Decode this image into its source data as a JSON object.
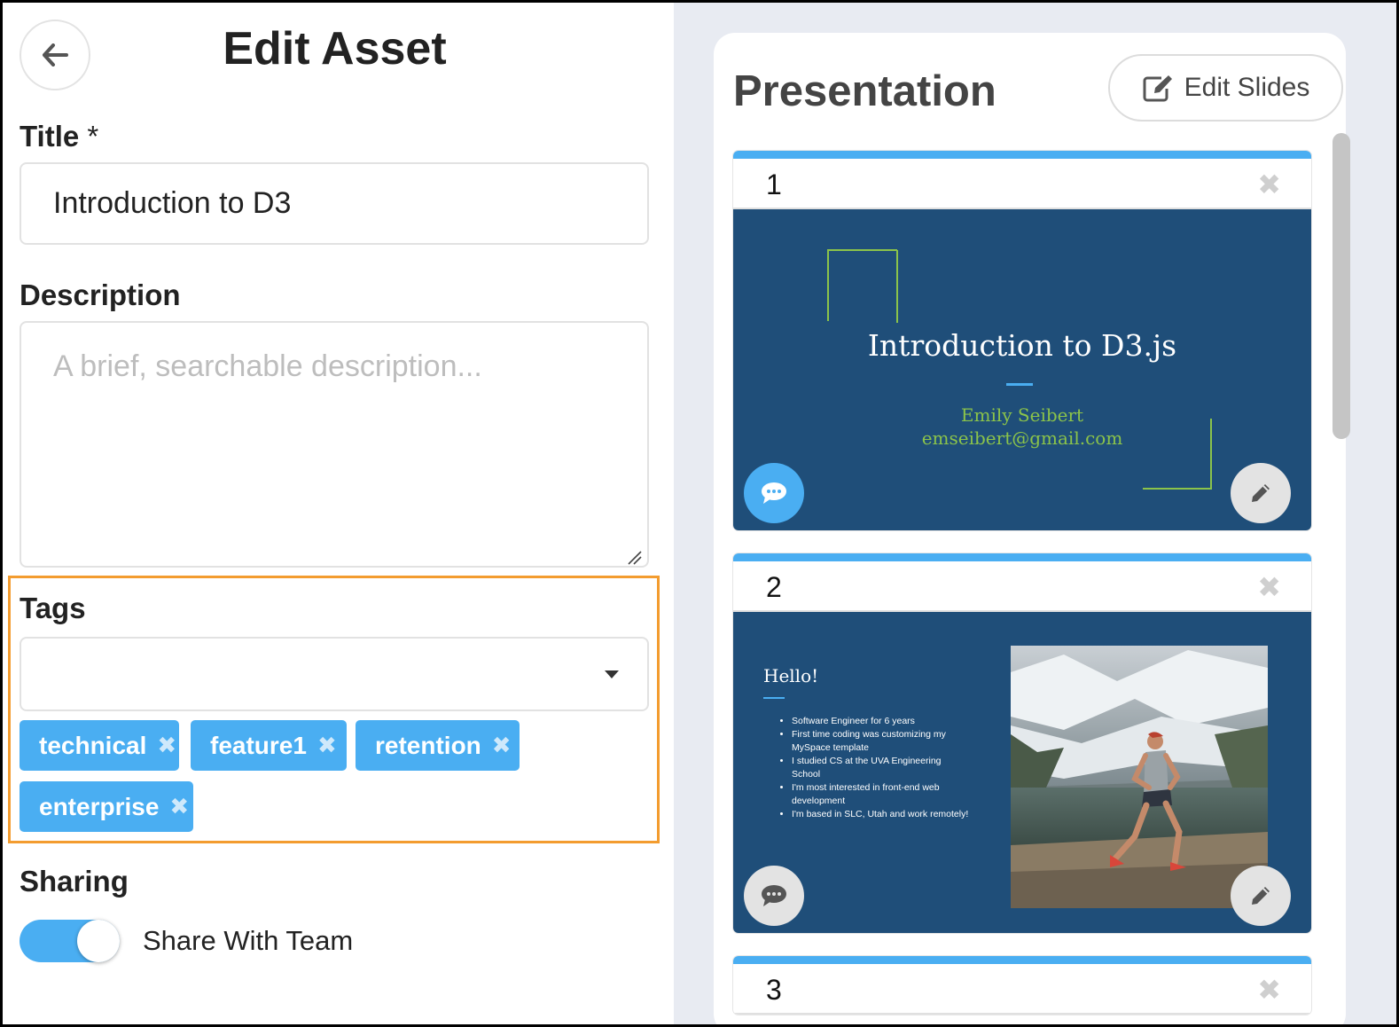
{
  "header": {
    "title": "Edit Asset"
  },
  "form": {
    "title_label": "Title",
    "title_required": "*",
    "title_value": "Introduction to D3",
    "description_label": "Description",
    "description_placeholder": "A brief, searchable description...",
    "tags_label": "Tags",
    "tags": [
      "technical",
      "feature1",
      "retention",
      "enterprise"
    ],
    "sharing_label": "Sharing",
    "share_toggle_label": "Share With Team",
    "share_toggle_on": true
  },
  "presentation": {
    "title": "Presentation",
    "edit_slides_label": "Edit Slides",
    "slides": [
      {
        "number": "1",
        "title": "Introduction to D3.js",
        "author": "Emily Seibert",
        "email": "emseibert@gmail.com"
      },
      {
        "number": "2",
        "heading": "Hello!",
        "bullets": [
          "Software Engineer for 6 years",
          "First time coding was customizing my MySpace template",
          "I studied CS at the UVA Engineering School",
          "I'm most interested in front-end web development",
          "I'm based in SLC, Utah and work remotely!"
        ]
      },
      {
        "number": "3"
      }
    ]
  },
  "colors": {
    "accent": "#4aaef2",
    "slide_bg": "#1f4e79",
    "highlight_border": "#f39c2f",
    "slide_green": "#8bc34a"
  },
  "icons": [
    "arrow-left-icon",
    "chevron-down-icon",
    "close-icon",
    "edit-icon",
    "comment-icon",
    "pencil-icon"
  ]
}
